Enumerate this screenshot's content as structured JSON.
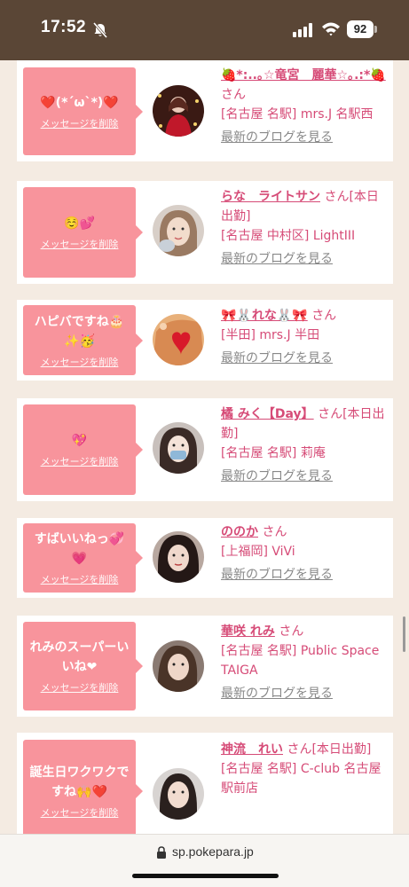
{
  "status_bar": {
    "time": "17:52",
    "battery": "92",
    "icons": [
      "bell-slash-icon",
      "cellular-signal-icon",
      "wifi-icon",
      "battery-icon"
    ]
  },
  "cards": [
    {
      "message": "❤️(*´ω`*)❤️",
      "delete_label": "メッセージを削除",
      "name": "🍓*:..｡☆竜宮　麗華☆｡.:*🍓",
      "suffix": "さん",
      "shop": "[名古屋 名駅] mrs.J 名駅西",
      "blog_label": "最新のブログを見る"
    },
    {
      "message": "☺️💕",
      "delete_label": "メッセージを削除",
      "name": "らな　ライトサン",
      "suffix": "さん[本日出勤]",
      "shop": "[名古屋 中村区] LightIII",
      "blog_label": "最新のブログを見る"
    },
    {
      "message": "ハピバですね🎂✨🥳",
      "delete_label": "メッセージを削除",
      "name": "🎀🐰れな🐰🎀",
      "suffix": "さん",
      "shop": "[半田] mrs.J 半田",
      "blog_label": "最新のブログを見る"
    },
    {
      "message": "💖",
      "delete_label": "メッセージを削除",
      "name": "橘 みく【Day】",
      "suffix": "さん[本日出勤]",
      "shop": "[名古屋 名駅] 莉庵",
      "blog_label": "最新のブログを見る"
    },
    {
      "message": "すばいいねっ💞💗",
      "delete_label": "メッセージを削除",
      "name": "ののか",
      "suffix": "さん",
      "shop": "[上福岡] ViVi",
      "blog_label": "最新のブログを見る"
    },
    {
      "message": "れみのスーパーいいね❤",
      "delete_label": "メッセージを削除",
      "name": "華咲 れみ",
      "suffix": "さん",
      "shop": "[名古屋 名駅] Public Space TAIGA",
      "blog_label": "最新のブログを見る"
    },
    {
      "message": "誕生日ワクワクですね🙌❤️",
      "delete_label": "メッセージを削除",
      "name": "神流　れい",
      "suffix": "さん[本日出勤]",
      "shop": "[名古屋 名駅] C-club 名古屋駅前店",
      "blog_label": "最新のブログを見る"
    }
  ],
  "browser": {
    "url": "sp.pokepara.jp"
  },
  "colors": {
    "status_bar": "#5a4636",
    "page_bg": "#f4ebe2",
    "bubble": "#f8949c",
    "accent_text": "#d64b77",
    "blog_link": "#888888"
  }
}
